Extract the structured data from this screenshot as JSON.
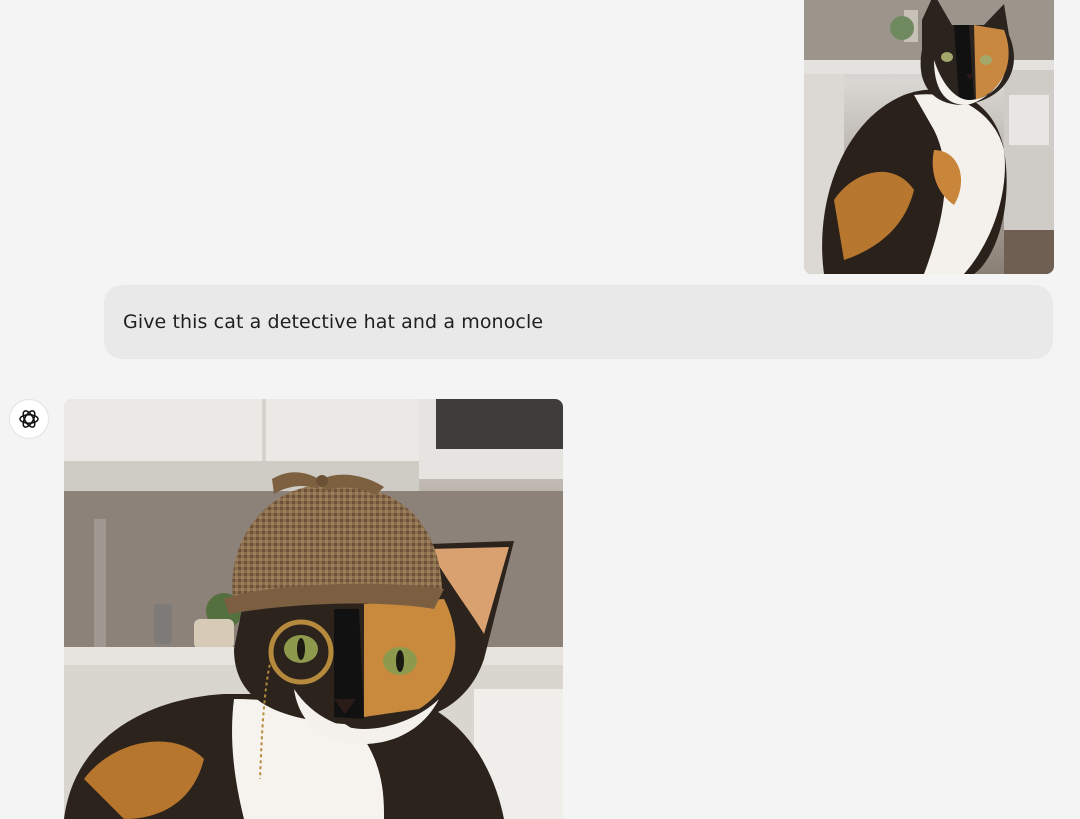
{
  "conversation": {
    "user_message": {
      "text": "Give this cat a detective hat and a monocle",
      "attachment_icon": "calico-cat-photo"
    },
    "assistant_message": {
      "avatar_icon": "openai-logo-icon",
      "generated_image_icon": "calico-cat-detective-hat-monocle-photo"
    }
  },
  "colors": {
    "background": "#f4f4f4",
    "user_bubble": "#e9e9e9",
    "text": "#1f1f1f"
  }
}
